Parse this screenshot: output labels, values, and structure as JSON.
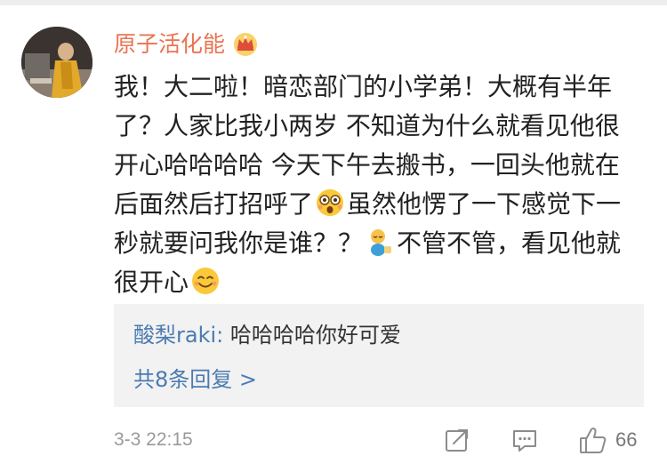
{
  "comment": {
    "username": "原子活化能",
    "badge_icon": "crown-icon",
    "text_line1": "我！大二啦！暗恋部门的小学弟！大概有半年了？人家比我小两岁 不知道为什么就看见他很开心哈哈哈哈 今天下午去搬书，一回头他就在后面然后打招呼了",
    "text_line2": "虽然他愣了一下感觉下一秒就要问我你是谁？？",
    "text_line3": "不管不管，看见他就很开心",
    "emoji_1": "wow-face-emoji",
    "emoji_2": "baby-emoji",
    "emoji_3": "smile-emoji"
  },
  "reply": {
    "author": "酸梨raki:",
    "text": " 哈哈哈哈你好可爱",
    "more": "共8条回复 >"
  },
  "footer": {
    "timestamp": "3-3 22:15",
    "like_count": "66"
  },
  "colors": {
    "username": "#eb7350",
    "link": "#4b7bb0",
    "reply_bg": "#f2f2f2",
    "muted": "#9a9a9a"
  }
}
